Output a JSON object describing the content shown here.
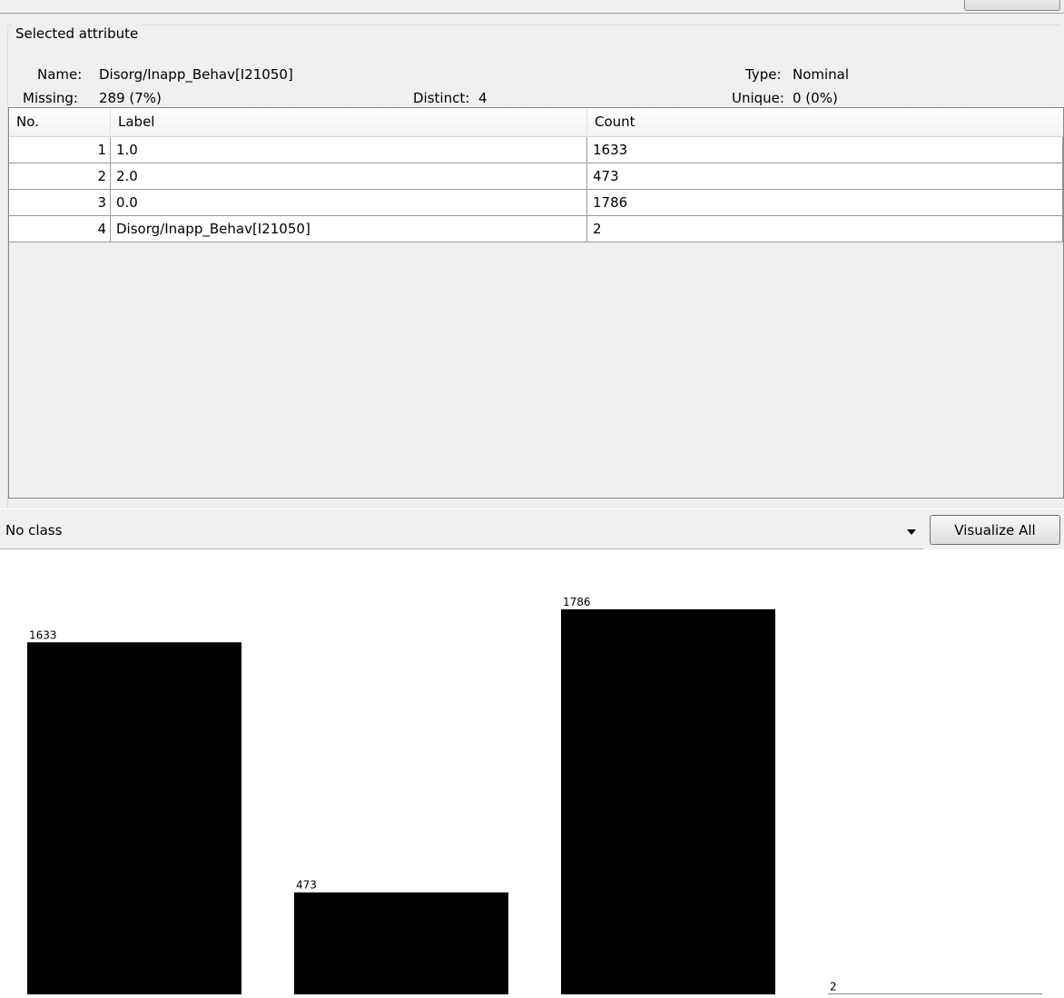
{
  "selected_attribute": {
    "legend": "Selected attribute",
    "name_label": "Name:",
    "name_value": "Disorg/Inapp_Behav[I21050]",
    "missing_label": "Missing:",
    "missing_value": "289 (7%)",
    "distinct_label": "Distinct:",
    "distinct_value": "4",
    "type_label": "Type:",
    "type_value": "Nominal",
    "unique_label": "Unique:",
    "unique_value": "0 (0%)"
  },
  "table": {
    "headers": [
      "No.",
      "Label",
      "Count"
    ],
    "rows": [
      {
        "no": "1",
        "label": "1.0",
        "count": "1633"
      },
      {
        "no": "2",
        "label": "2.0",
        "count": "473"
      },
      {
        "no": "3",
        "label": "0.0",
        "count": "1786"
      },
      {
        "no": "4",
        "label": "Disorg/Inapp_Behav[I21050]",
        "count": "2"
      }
    ]
  },
  "class_selector": {
    "value": "No class",
    "icon": "chevron-down-icon"
  },
  "visualize_all_label": "Visualize All",
  "chart_data": {
    "type": "bar",
    "categories": [
      "1.0",
      "2.0",
      "0.0",
      "Disorg/Inapp_Behav[I21050]"
    ],
    "values": [
      1633,
      473,
      1786,
      2
    ],
    "data_labels": [
      "1633",
      "473",
      "1786",
      "2"
    ],
    "bar_color": "#000000"
  }
}
